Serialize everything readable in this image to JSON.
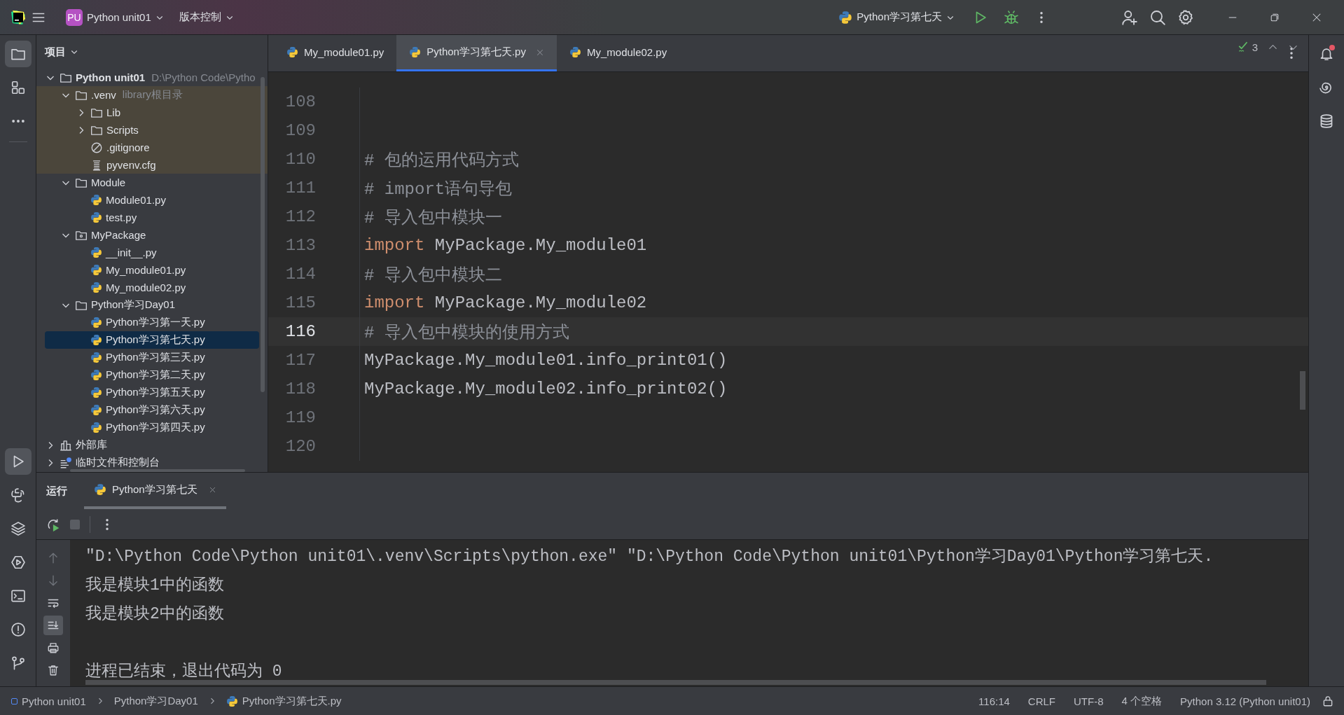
{
  "title_bar": {
    "project_badge": "PU",
    "project": "Python unit01",
    "vcs": "版本控制",
    "run_config": "Python学习第七天"
  },
  "left_tools_top": [
    {
      "kind": "project",
      "selected": true
    },
    {
      "kind": "structure",
      "selected": false
    },
    {
      "kind": "more",
      "selected": false
    }
  ],
  "left_tools_bottom": [
    {
      "kind": "run",
      "selected": true
    },
    {
      "kind": "python-console",
      "selected": false
    },
    {
      "kind": "layers",
      "selected": false
    },
    {
      "kind": "services",
      "selected": false
    },
    {
      "kind": "terminal",
      "selected": false
    },
    {
      "kind": "problems",
      "selected": false
    },
    {
      "kind": "git",
      "selected": false
    }
  ],
  "right_tools": [
    {
      "kind": "notifications",
      "badge": true
    },
    {
      "kind": "assistant",
      "badge": false
    },
    {
      "kind": "database",
      "badge": false
    }
  ],
  "project_panel": {
    "title": "项目",
    "tree": [
      {
        "kind": "project",
        "name": "Python unit01",
        "hint": "D:\\Python Code\\Pytho",
        "expanded": true,
        "excluded": false,
        "selected": false,
        "children": [
          {
            "kind": "folder",
            "name": ".venv",
            "hint": "library根目录",
            "expanded": true,
            "excluded": true,
            "selected": false,
            "children": [
              {
                "kind": "folder",
                "name": "Lib",
                "expanded": false,
                "excluded": true,
                "selected": false
              },
              {
                "kind": "folder",
                "name": "Scripts",
                "expanded": false,
                "excluded": true,
                "selected": false
              },
              {
                "kind": "ignore",
                "name": ".gitignore",
                "excluded": true,
                "selected": false
              },
              {
                "kind": "config",
                "name": "pyvenv.cfg",
                "excluded": true,
                "selected": false
              }
            ]
          },
          {
            "kind": "folder",
            "name": "Module",
            "expanded": true,
            "excluded": false,
            "selected": false,
            "children": [
              {
                "kind": "python",
                "name": "Module01.py",
                "excluded": false,
                "selected": false
              },
              {
                "kind": "python",
                "name": "test.py",
                "excluded": false,
                "selected": false
              }
            ]
          },
          {
            "kind": "package",
            "name": "MyPackage",
            "expanded": true,
            "excluded": false,
            "selected": false,
            "children": [
              {
                "kind": "python",
                "name": "__init__.py",
                "excluded": false,
                "selected": false
              },
              {
                "kind": "python",
                "name": "My_module01.py",
                "excluded": false,
                "selected": false
              },
              {
                "kind": "python",
                "name": "My_module02.py",
                "excluded": false,
                "selected": false
              }
            ]
          },
          {
            "kind": "folder",
            "name": "Python学习Day01",
            "expanded": true,
            "excluded": false,
            "selected": false,
            "children": [
              {
                "kind": "python",
                "name": "Python学习第一天.py",
                "excluded": false,
                "selected": false
              },
              {
                "kind": "python",
                "name": "Python学习第七天.py",
                "excluded": false,
                "selected": true
              },
              {
                "kind": "python",
                "name": "Python学习第三天.py",
                "excluded": false,
                "selected": false
              },
              {
                "kind": "python",
                "name": "Python学习第二天.py",
                "excluded": false,
                "selected": false
              },
              {
                "kind": "python",
                "name": "Python学习第五天.py",
                "excluded": false,
                "selected": false
              },
              {
                "kind": "python",
                "name": "Python学习第六天.py",
                "excluded": false,
                "selected": false
              },
              {
                "kind": "python",
                "name": "Python学习第四天.py",
                "excluded": false,
                "selected": false
              }
            ]
          }
        ]
      },
      {
        "kind": "library",
        "name": "外部库",
        "expanded": false,
        "excluded": false,
        "selected": false
      },
      {
        "kind": "scratch",
        "name": "临时文件和控制台",
        "expanded": false,
        "excluded": false,
        "selected": false
      }
    ]
  },
  "editor": {
    "tabs": [
      {
        "label": "My_module01.py",
        "selected": false
      },
      {
        "label": "Python学习第七天.py",
        "selected": true
      },
      {
        "label": "My_module02.py",
        "selected": false
      }
    ],
    "inspections": "3",
    "lines": [
      {
        "number": "108",
        "current": false
      },
      {
        "number": "109",
        "current": false
      },
      {
        "number": "110",
        "current": false,
        "tokens": [
          {
            "kind": "comment",
            "text": "# 包的运用代码方式"
          }
        ]
      },
      {
        "number": "111",
        "current": false,
        "tokens": [
          {
            "kind": "comment",
            "text": "# import语句导包"
          }
        ]
      },
      {
        "number": "112",
        "current": false,
        "tokens": [
          {
            "kind": "comment",
            "text": "# 导入包中模块一"
          }
        ]
      },
      {
        "number": "113",
        "current": false,
        "tokens": [
          {
            "kind": "keyword",
            "text": "import"
          },
          {
            "kind": "plain",
            "text": " MyPackage.My_module01"
          }
        ]
      },
      {
        "number": "114",
        "current": false,
        "tokens": [
          {
            "kind": "comment",
            "text": "# 导入包中模块二"
          }
        ]
      },
      {
        "number": "115",
        "current": false,
        "tokens": [
          {
            "kind": "keyword",
            "text": "import"
          },
          {
            "kind": "plain",
            "text": " MyPackage.My_module02"
          }
        ]
      },
      {
        "number": "116",
        "current": true,
        "tokens": [
          {
            "kind": "comment",
            "text": "# 导入包中模块的使用方式"
          }
        ]
      },
      {
        "number": "117",
        "current": false,
        "tokens": [
          {
            "kind": "plain",
            "text": "MyPackage.My_module01.info_print01()"
          }
        ]
      },
      {
        "number": "118",
        "current": false,
        "tokens": [
          {
            "kind": "plain",
            "text": "MyPackage.My_module02.info_print02()"
          }
        ]
      },
      {
        "number": "119",
        "current": false
      },
      {
        "number": "120",
        "current": false
      }
    ]
  },
  "run_panel": {
    "title": "运行",
    "tabs": [
      {
        "label": "Python学习第七天",
        "selected": true
      }
    ],
    "console_tools": [
      {
        "kind": "up",
        "selected": false
      },
      {
        "kind": "down",
        "selected": false
      },
      {
        "kind": "wrap",
        "selected": false
      },
      {
        "kind": "scroll-end",
        "selected": true
      },
      {
        "kind": "print",
        "selected": false
      },
      {
        "kind": "delete",
        "selected": false
      }
    ],
    "console": [
      {
        "kind": "command",
        "text": "\"D:\\Python Code\\Python unit01\\.venv\\Scripts\\python.exe\" \"D:\\Python Code\\Python unit01\\Python学习Day01\\Python学习第七天."
      },
      {
        "kind": "output",
        "text": "我是模块1中的函数"
      },
      {
        "kind": "output",
        "text": "我是模块2中的函数"
      },
      {
        "kind": "exit",
        "text": "进程已结束，退出代码为 0"
      }
    ]
  },
  "status_bar": {
    "breadcrumbs": [
      {
        "kind": "project",
        "text": "Python unit01"
      },
      {
        "kind": "folder",
        "text": "Python学习Day01"
      },
      {
        "kind": "python",
        "text": "Python学习第七天.py"
      }
    ],
    "items": [
      "116:14",
      "CRLF",
      "UTF-8",
      "4 个空格",
      "Python 3.12 (Python unit01)"
    ]
  }
}
